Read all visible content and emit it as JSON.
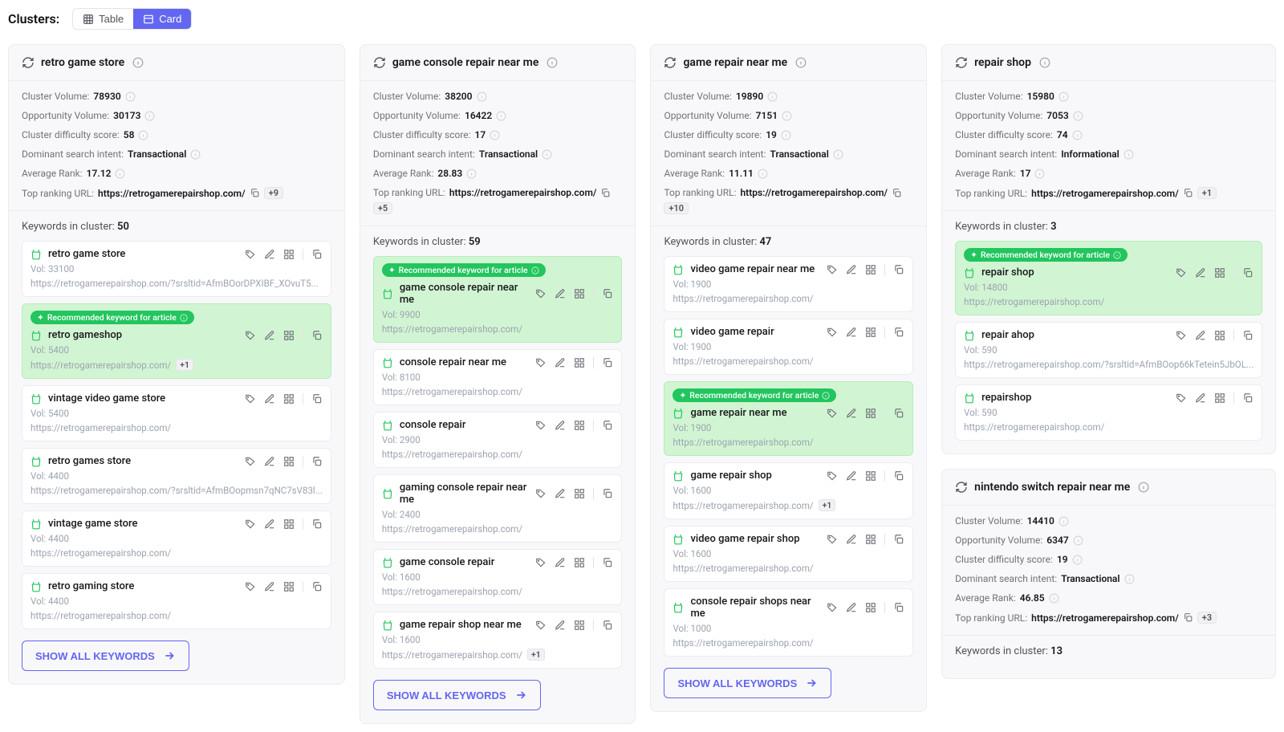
{
  "header": {
    "label": "Clusters:",
    "table": "Table",
    "card": "Card"
  },
  "labels": {
    "cv": "Cluster Volume:",
    "ov": "Opportunity Volume:",
    "cds": "Cluster difficulty score:",
    "dsi": "Dominant search intent:",
    "ar": "Average Rank:",
    "tru": "Top ranking URL:",
    "kic": "Keywords in cluster:",
    "rec": "Recommended keyword for article",
    "show": "SHOW ALL KEYWORDS",
    "vol": "Vol:"
  },
  "columns": [
    [
      {
        "title": "retro game store",
        "stats": {
          "cv": "78930",
          "ov": "30173",
          "cds": "58",
          "dsi": "Transactional",
          "ar": "17.12",
          "tru": "https://retrogamerepairshop.com/",
          "badge": "+9"
        },
        "kwcount": "50",
        "keywords": [
          {
            "name": "retro game store",
            "vol": "33100",
            "url": "https://retrogamerepairshop.com/?srsltid=AfmBOorDPXIBF_XOvuT5...",
            "rec": false
          },
          {
            "name": "retro gameshop",
            "vol": "5400",
            "url": "https://retrogamerepairshop.com/",
            "rec": true,
            "badge": "+1"
          },
          {
            "name": "vintage video game store",
            "vol": "5400",
            "url": "https://retrogamerepairshop.com/",
            "rec": false
          },
          {
            "name": "retro games store",
            "vol": "4400",
            "url": "https://retrogamerepairshop.com/?srsltid=AfmBOopmsn7qNC7sV83l...",
            "rec": false
          },
          {
            "name": "vintage game store",
            "vol": "4400",
            "url": "https://retrogamerepairshop.com/",
            "rec": false
          },
          {
            "name": "retro gaming store",
            "vol": "4400",
            "url": "https://retrogamerepairshop.com/",
            "rec": false
          }
        ],
        "showAll": true
      }
    ],
    [
      {
        "title": "game console repair near me",
        "stats": {
          "cv": "38200",
          "ov": "16422",
          "cds": "17",
          "dsi": "Transactional",
          "ar": "28.83",
          "tru": "https://retrogamerepairshop.com/",
          "badge": "+5"
        },
        "kwcount": "59",
        "keywords": [
          {
            "name": "game console repair near me",
            "vol": "9900",
            "url": "https://retrogamerepairshop.com/",
            "rec": true
          },
          {
            "name": "console repair near me",
            "vol": "8100",
            "url": "https://retrogamerepairshop.com/",
            "rec": false
          },
          {
            "name": "console repair",
            "vol": "2900",
            "url": "https://retrogamerepairshop.com/",
            "rec": false
          },
          {
            "name": "gaming console repair near me",
            "vol": "2400",
            "url": "https://retrogamerepairshop.com/",
            "rec": false
          },
          {
            "name": "game console repair",
            "vol": "1600",
            "url": "https://retrogamerepairshop.com/",
            "rec": false
          },
          {
            "name": "game repair shop near me",
            "vol": "1600",
            "url": "https://retrogamerepairshop.com/",
            "rec": false,
            "badge": "+1"
          }
        ],
        "showAll": true
      }
    ],
    [
      {
        "title": "game repair near me",
        "stats": {
          "cv": "19890",
          "ov": "7151",
          "cds": "19",
          "dsi": "Transactional",
          "ar": "11.11",
          "tru": "https://retrogamerepairshop.com/",
          "badge": "+10"
        },
        "kwcount": "47",
        "keywords": [
          {
            "name": "video game repair near me",
            "vol": "1900",
            "url": "https://retrogamerepairshop.com/",
            "rec": false
          },
          {
            "name": "video game repair",
            "vol": "1900",
            "url": "https://retrogamerepairshop.com/",
            "rec": false
          },
          {
            "name": "game repair near me",
            "vol": "1900",
            "url": "https://retrogamerepairshop.com/",
            "rec": true
          },
          {
            "name": "game repair shop",
            "vol": "1600",
            "url": "https://retrogamerepairshop.com/",
            "rec": false,
            "badge": "+1"
          },
          {
            "name": "video game repair shop",
            "vol": "1600",
            "url": "https://retrogamerepairshop.com/",
            "rec": false
          },
          {
            "name": "console repair shops near me",
            "vol": "1000",
            "url": "https://retrogamerepairshop.com/",
            "rec": false
          }
        ],
        "showAll": true
      }
    ],
    [
      {
        "title": "repair shop",
        "stats": {
          "cv": "15980",
          "ov": "7053",
          "cds": "74",
          "dsi": "Informational",
          "ar": "17",
          "tru": "https://retrogamerepairshop.com/",
          "badge": "+1"
        },
        "kwcount": "3",
        "keywords": [
          {
            "name": "repair shop",
            "vol": "14800",
            "url": "https://retrogamerepairshop.com/",
            "rec": true
          },
          {
            "name": "repair ahop",
            "vol": "590",
            "url": "https://retrogamerepairshop.com/?srsltid=AfmBOop66kTetein5JbOL...",
            "rec": false
          },
          {
            "name": "repairshop",
            "vol": "590",
            "url": "https://retrogamerepairshop.com/",
            "rec": false
          }
        ],
        "showAll": false
      },
      {
        "title": "nintendo switch repair near me",
        "stats": {
          "cv": "14410",
          "ov": "6347",
          "cds": "19",
          "dsi": "Transactional",
          "ar": "46.85",
          "tru": "https://retrogamerepairshop.com/",
          "badge": "+3"
        },
        "kwcount": "13",
        "keywords": [],
        "showAll": false
      }
    ]
  ]
}
